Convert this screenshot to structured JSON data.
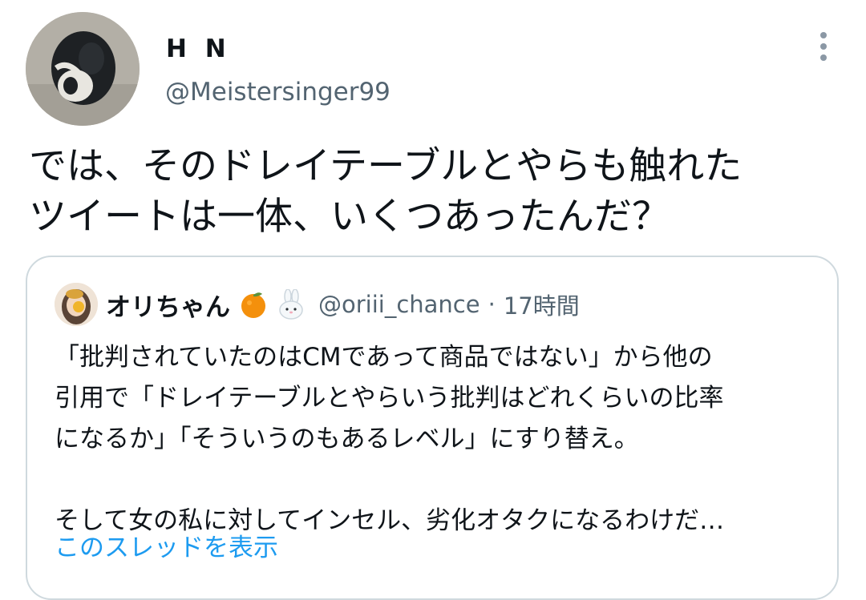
{
  "tweet": {
    "author": {
      "name": "H N",
      "handle": "@Meistersinger99",
      "avatar_icon": "penguin-avatar"
    },
    "more_icon": "more-vertical-icon",
    "text": "では、そのドレイテーブルとやらも触れた\nツイートは一体、いくつあったんだ？",
    "quote": {
      "author": {
        "name": "オリちゃん",
        "emoji": [
          "tangerine-emoji",
          "rabbit-emoji"
        ],
        "handle": "@oriii_chance",
        "separator": "·",
        "time": "17時間",
        "avatar_icon": "user-avatar"
      },
      "text": "「批判されていたのはCMであって商品ではない」から他の\n引用で「ドレイテーブルとやらいう批判はどれくらいの比率\nになるか」「そういうのもあるレベル」にすり替え。\n\nそして女の私に対してインセル、劣化オタクになるわけだ…",
      "thread_link": "このスレッドを表示"
    }
  },
  "colors": {
    "text_primary": "#0f1419",
    "text_secondary": "#536471",
    "link": "#1d9bf0",
    "border": "#cfd9de"
  }
}
